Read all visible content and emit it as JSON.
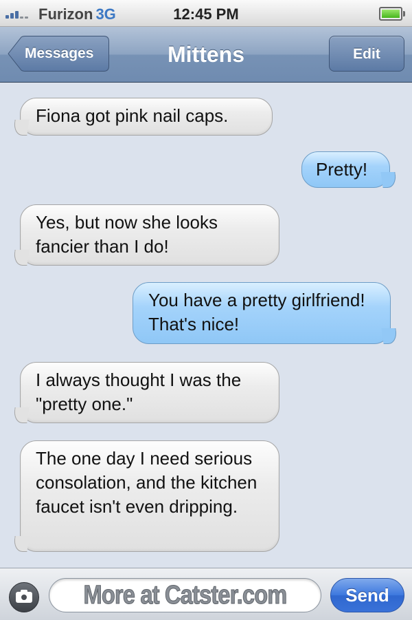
{
  "status_bar": {
    "carrier": "Furizon",
    "network": "3G",
    "time": "12:45 PM",
    "battery_level": 0.9,
    "signal_bars": 3
  },
  "nav": {
    "back_label": "Messages",
    "title": "Mittens",
    "edit_label": "Edit"
  },
  "messages": [
    {
      "direction": "incoming",
      "text": "Fiona got pink nail caps."
    },
    {
      "direction": "outgoing",
      "text": "Pretty!"
    },
    {
      "direction": "incoming",
      "text": "Yes, but now she looks fancier than I do!"
    },
    {
      "direction": "outgoing",
      "text": "You have a pretty girlfriend! That's nice!"
    },
    {
      "direction": "incoming",
      "text": "I always thought I was the \"pretty one.\""
    },
    {
      "direction": "incoming",
      "text": "The one day I need serious consolation, and the kitchen faucet isn't even dripping."
    }
  ],
  "compose": {
    "camera_icon": "camera-icon",
    "input_value": "More at Catster.com",
    "send_label": "Send"
  },
  "colors": {
    "background": "#dbe2ed",
    "incoming_bubble": "#e2e2e2",
    "outgoing_bubble": "#92c8f6",
    "nav_bar": "#7792b5",
    "send_button": "#3d78de"
  }
}
